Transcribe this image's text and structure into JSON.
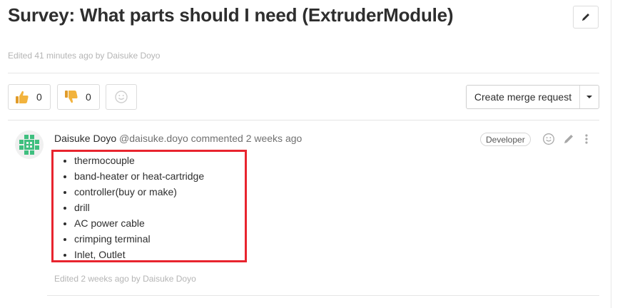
{
  "issue": {
    "title": "Survey: What parts should I need (ExtruderModule)",
    "edited_prefix": "Edited 41 minutes ago by ",
    "edited_by": "Daisuke Doyo"
  },
  "awards": [
    {
      "icon": "thumbs-up-icon",
      "count": "0"
    },
    {
      "icon": "thumbs-down-icon",
      "count": "0"
    },
    {
      "icon": "smiley-icon"
    }
  ],
  "merge_request": {
    "label": "Create merge request"
  },
  "comment": {
    "author": "Daisuke Doyo",
    "handle": "@daisuke.doyo",
    "verb": "commented",
    "time": "2 weeks ago",
    "role": "Developer",
    "items": [
      "thermocouple",
      "band-heater or heat-cartridge",
      "controller(buy or make)",
      "drill",
      "AC power cable",
      "crimping terminal",
      "Inlet, Outlet"
    ],
    "edited_prefix": "Edited 2 weeks ago by ",
    "edited_by": "Daisuke Doyo"
  },
  "colors": {
    "highlight": "#e8242e",
    "avatar": "#3fbf7f",
    "thumb": "#f2b33d"
  }
}
